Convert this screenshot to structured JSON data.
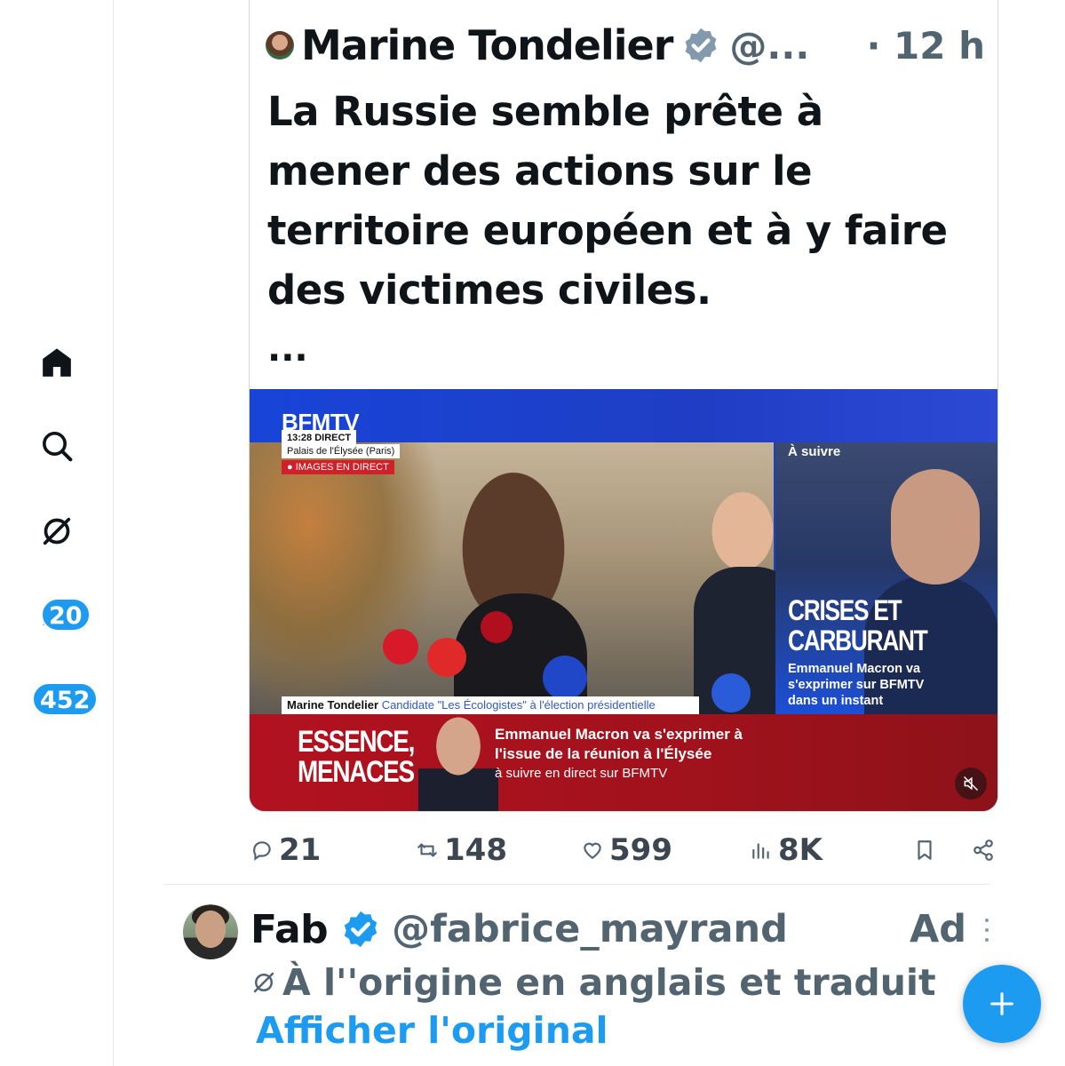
{
  "nav": {
    "items": [
      {
        "name": "home",
        "icon": "home-icon"
      },
      {
        "name": "search",
        "icon": "search-icon"
      },
      {
        "name": "grok",
        "icon": "grok-icon"
      },
      {
        "name": "notifications",
        "icon": "bell-icon",
        "badge": "20"
      },
      {
        "name": "messages",
        "icon": "mail-icon",
        "badge": "452"
      }
    ]
  },
  "quoted_tweet": {
    "author_name": "Marine Tondelier",
    "handle": "@...",
    "time": "· 12 h",
    "text": "La Russie semble prête à mener des actions sur le territoire européen et à y faire des victimes civiles.",
    "more": "...",
    "video": {
      "channel": "BFMTV",
      "time_direct": "13:28  DIRECT",
      "location": "Palais de l'Élysée (Paris)",
      "live_tag": "● IMAGES EN DIRECT",
      "side_label": "À suivre",
      "side_headline_1": "CRISES ET",
      "side_headline_2": "CARBURANT",
      "side_sub": "Emmanuel Macron va s'exprimer sur BFMTV dans un instant",
      "lower_name": "Marine Tondelier",
      "lower_role": "Candidate \"Les Écologistes\" à l'élection présidentielle",
      "band_title_1": "ESSENCE,",
      "band_title_2": "MENACES",
      "band_text": "Emmanuel Macron va s'exprimer à l'issue de la réunion à l'Élysée",
      "band_small": "à suivre en direct sur BFMTV"
    }
  },
  "actions": {
    "replies": "21",
    "reposts": "148",
    "likes": "599",
    "views": "8K"
  },
  "next_tweet": {
    "author_name": "Fab",
    "handle": "@fabrice_mayrand",
    "ad_label": "Ad",
    "translated_note": "À l''origine en anglais et traduit",
    "show_original": "Afficher l'original"
  },
  "colors": {
    "accent": "#1d9bf0",
    "text": "#0f1419",
    "muted": "#536471",
    "bfm_blue": "#1844d8",
    "bfm_red": "#b2121f"
  }
}
